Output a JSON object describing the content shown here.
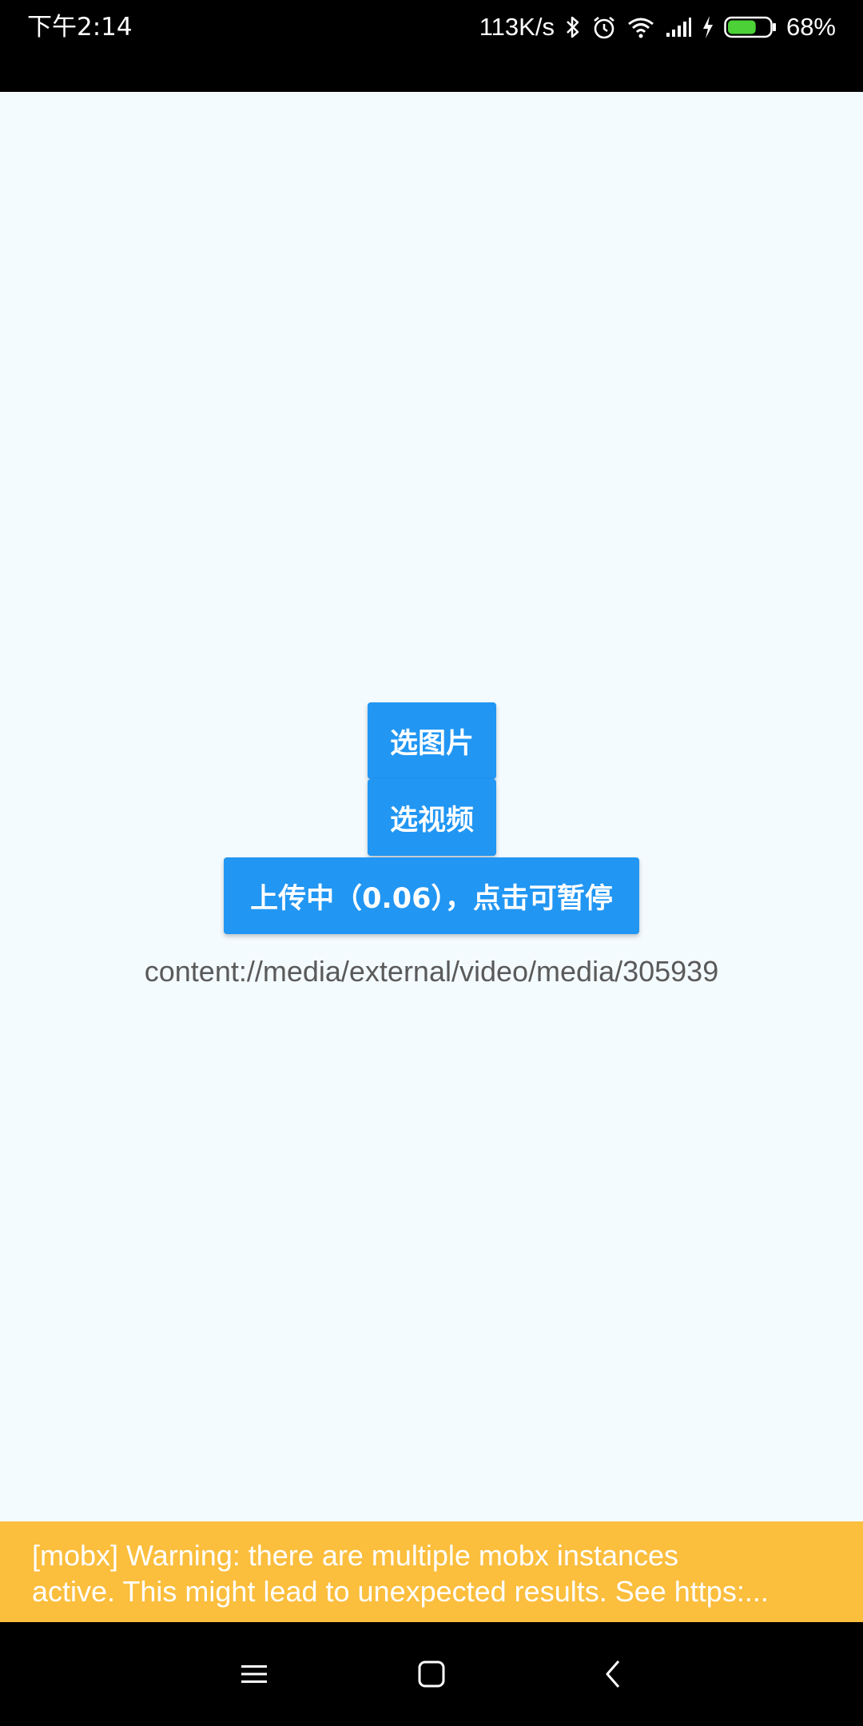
{
  "status_bar": {
    "time": "下午2:14",
    "network_speed": "113K/s",
    "battery_percent": "68%",
    "battery_level": 0.68,
    "battery_color": "#4cd137",
    "icons": [
      "bluetooth-icon",
      "alarm-icon",
      "wifi-icon",
      "signal-icon",
      "charging-icon",
      "battery-icon"
    ]
  },
  "main": {
    "pick_image_label": "选图片",
    "pick_video_label": "选视频",
    "upload_label": "上传中（0.06），点击可暂停",
    "upload_progress": 0.06,
    "selected_uri": "content://media/external/video/media/305939",
    "accent_color": "#2196f3"
  },
  "warning": {
    "line1": "[mobx] Warning: there are multiple mobx instances",
    "line2": "active. This might lead to unexpected results. See https:...",
    "color": "#fbbe3d"
  },
  "nav_bar": {
    "icons": [
      "menu-icon",
      "home-icon",
      "back-icon"
    ]
  }
}
